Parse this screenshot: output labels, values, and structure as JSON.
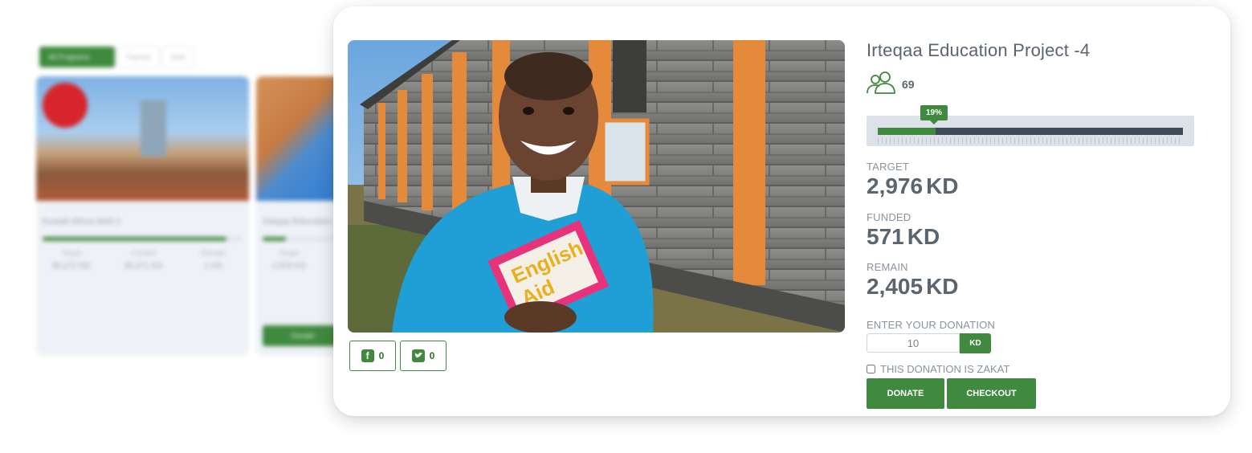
{
  "background": {
    "tabs": [
      "All Programs",
      "Popular",
      "New"
    ],
    "cards": [
      {
        "title": "Kuwait Africa Well 2",
        "progress": 0.92,
        "stats": [
          "Target",
          "Funded",
          "Remain"
        ],
        "values": [
          "50,272 KD",
          "50,271 KD",
          "1 KD"
        ]
      },
      {
        "title": "Irteqaa Education",
        "progress": 0.3,
        "stats": [
          "Target"
        ],
        "values": [
          "2,976 KD"
        ],
        "button": "Donate"
      }
    ]
  },
  "project": {
    "title": "Irteqaa Education Project -4",
    "donor_count": "69",
    "progress_percent": 19,
    "progress_label": "19%",
    "target_label": "TARGET",
    "target_value": "2,976",
    "funded_label": "FUNDED",
    "funded_value": "571",
    "remain_label": "REMAIN",
    "remain_value": "2,405",
    "currency": "KD"
  },
  "share": {
    "facebook_count": "0",
    "twitter_count": "0"
  },
  "donation": {
    "label": "ENTER YOUR DONATION",
    "amount": "10",
    "unit": "KD",
    "zakat_label": "THIS DONATION IS ZAKAT",
    "donate_label": "DONATE",
    "checkout_label": "CHECKOUT"
  },
  "colors": {
    "accent": "#3f8a3e",
    "progress_track": "#3f4a5a",
    "progress_box": "#dde2e9"
  }
}
